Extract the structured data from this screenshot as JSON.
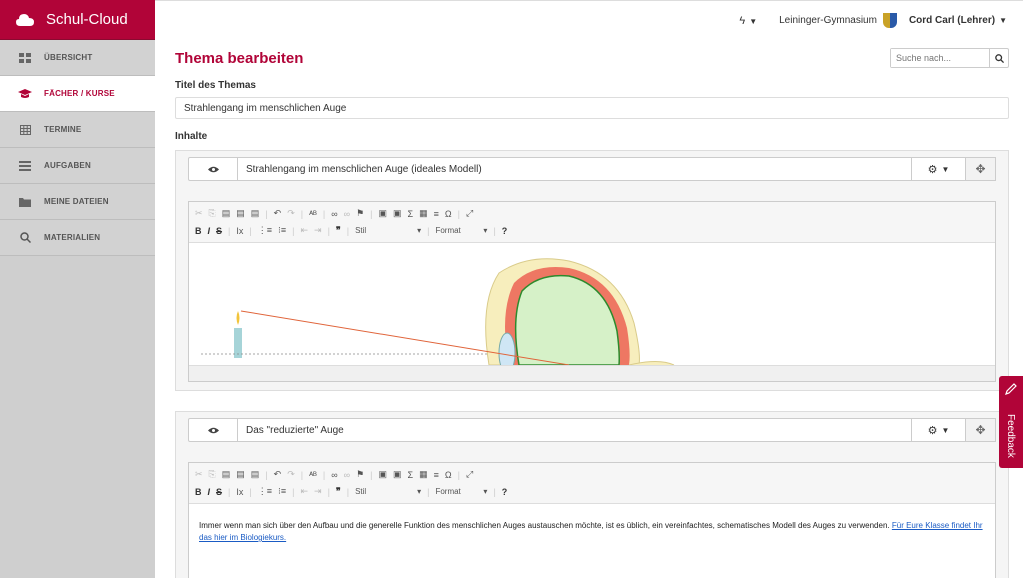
{
  "brand": {
    "name": "Schul-Cloud"
  },
  "nav": [
    {
      "label": "ÜBERSICHT",
      "icon": "dashboard-icon",
      "active": false
    },
    {
      "label": "FÄCHER / KURSE",
      "icon": "graduation-cap-icon",
      "active": true
    },
    {
      "label": "TERMINE",
      "icon": "calendar-icon",
      "active": false
    },
    {
      "label": "AUFGABEN",
      "icon": "tasks-icon",
      "active": false
    },
    {
      "label": "MEINE DATEIEN",
      "icon": "folder-icon",
      "active": false
    },
    {
      "label": "MATERIALIEN",
      "icon": "search-icon",
      "active": false
    }
  ],
  "topbar": {
    "school": "Leininger-Gymnasium",
    "user": "Cord Carl (Lehrer)"
  },
  "page": {
    "title": "Thema bearbeiten",
    "search_placeholder": "Suche nach...",
    "topic_label": "Titel des Themas",
    "topic_value": "Strahlengang im menschlichen Auge",
    "contents_label": "Inhalte"
  },
  "blocks": [
    {
      "title": "Strahlengang im menschlichen Auge (ideales Modell)"
    },
    {
      "title": "Das \"reduzierte\" Auge",
      "text": "Immer wenn man sich über den Aufbau und die generelle Funktion des menschlichen Auges austauschen möchte, ist es üblich, ein vereinfachtes, schematisches Modell des Auges zu verwenden.",
      "link": "Für Eure Klasse findet Ihr das hier im Biologiekurs."
    }
  ],
  "editor": {
    "style_label": "Stil",
    "format_label": "Format",
    "help_label": "?"
  },
  "feedback": {
    "label": "Feedback"
  },
  "colors": {
    "brand": "#b10438",
    "sidebar": "#cfcfcf",
    "link": "#1a5bc4"
  }
}
